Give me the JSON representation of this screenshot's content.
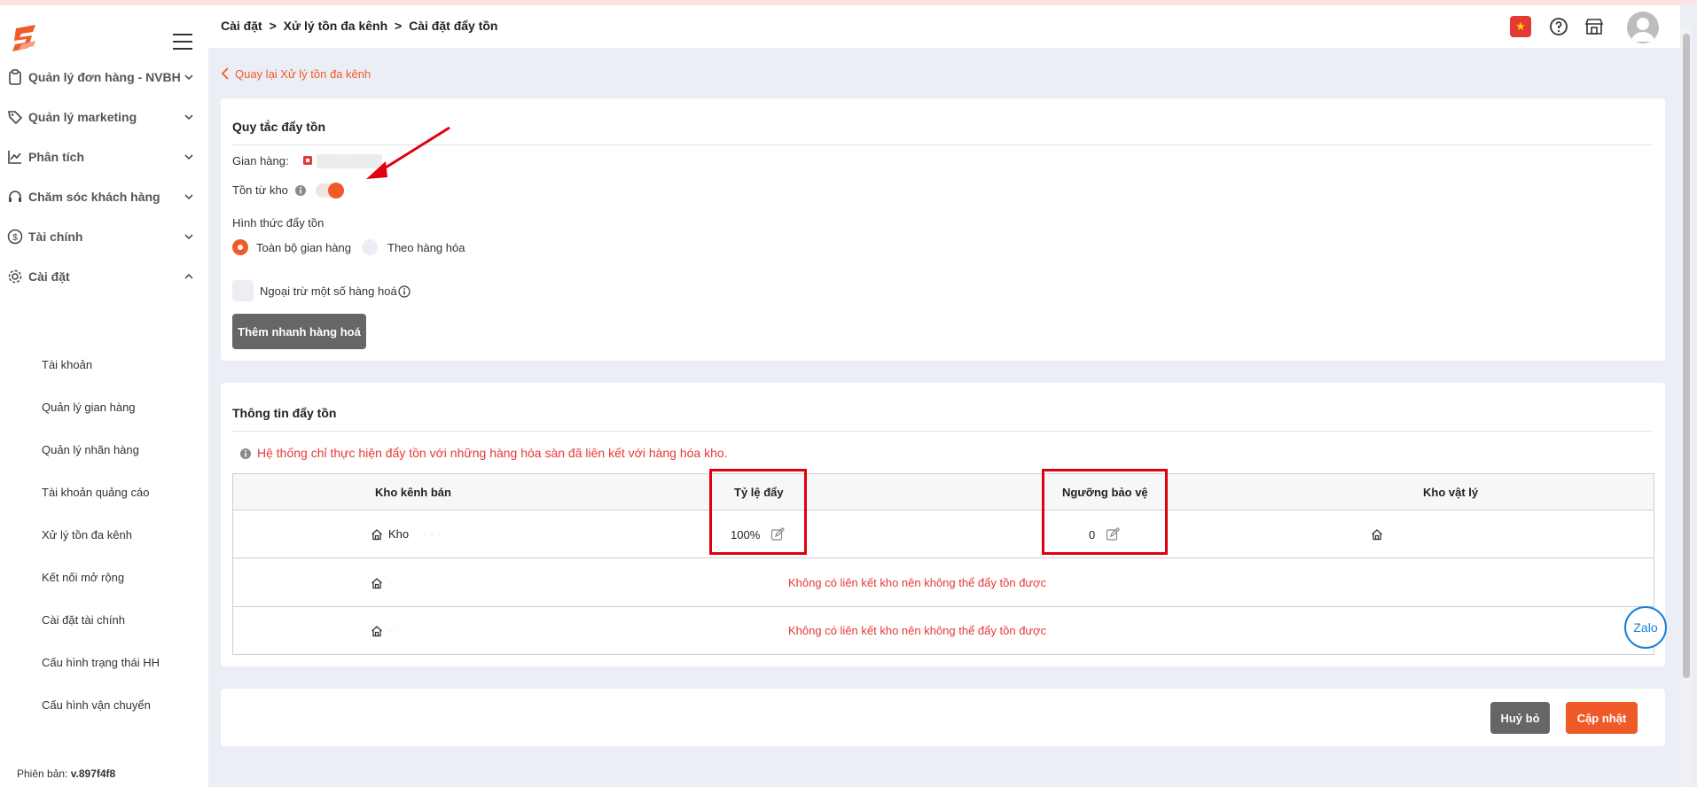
{
  "sidebar": {
    "menu_groups": [
      {
        "label": "Quản lý đơn hàng - NVBH",
        "icon": "clipboard-icon"
      },
      {
        "label": "Quản lý marketing",
        "icon": "tag-icon"
      },
      {
        "label": "Phân tích",
        "icon": "chart-icon"
      },
      {
        "label": "Chăm sóc khách hàng",
        "icon": "headset-icon"
      },
      {
        "label": "Tài chính",
        "icon": "dollar-icon"
      },
      {
        "label": "Cài đặt",
        "icon": "gear-icon"
      }
    ],
    "settings_items": [
      "Tài khoản",
      "Quản lý gian hàng",
      "Quản lý nhãn hàng",
      "Tài khoản quảng cáo",
      "Xử lý tồn đa kênh",
      "Kết nối mở rộng",
      "Cài đặt tài chính",
      "Cấu hình trạng thái HH",
      "Cấu hình vận chuyển"
    ],
    "version_label": "Phiên bản:",
    "version_value": "v.897f4f8"
  },
  "header": {
    "breadcrumb": [
      "Cài đặt",
      ">",
      "Xử lý tồn đa kênh",
      ">",
      "Cài đặt đẩy tồn"
    ],
    "flag_icon": "vietnam-flag-icon"
  },
  "back_link": "Quay lại Xử lý tồn đa kênh",
  "rules": {
    "title": "Quy tắc đẩy tồn",
    "shop_label": "Gian hàng:",
    "stock_from_warehouse_label": "Tồn từ kho",
    "push_type_label": "Hình thức đẩy tồn",
    "radio_all": "Toàn bộ gian hàng",
    "radio_by_product": "Theo hàng hóa",
    "exclude_label": "Ngoại trừ một số hàng hoá",
    "quick_add_button": "Thêm nhanh hàng hoá"
  },
  "info": {
    "title": "Thông tin đẩy tồn",
    "notice": "Hệ thống chỉ thực hiện đẩy tồn với những hàng hóa sàn đã liên kết với hàng hóa kho.",
    "columns": [
      "Kho kênh bán",
      "Tỷ lệ đẩy",
      "Ngưỡng bảo vệ",
      "Kho vật lý"
    ],
    "rows": [
      {
        "channel": "Kho",
        "channel_blur": "· · · ·",
        "ratio": "100%",
        "threshold": "0",
        "physical_blur": "· · · · · ·"
      },
      {
        "channel": "",
        "channel_blur": "· · ·",
        "message": "Không có liên kết kho nên không thể đẩy tồn được"
      },
      {
        "channel": "",
        "channel_blur": "· ·",
        "message": "Không có liên kết kho nên không thể đẩy tồn được"
      }
    ]
  },
  "footer": {
    "cancel_button": "Huỷ bỏ",
    "update_button": "Cập nhật"
  },
  "zalo_label": "Zalo",
  "colors": {
    "accent": "#f05a28",
    "error": "#e53935",
    "highlight_box": "#e0000f",
    "dark_button": "#666666"
  }
}
